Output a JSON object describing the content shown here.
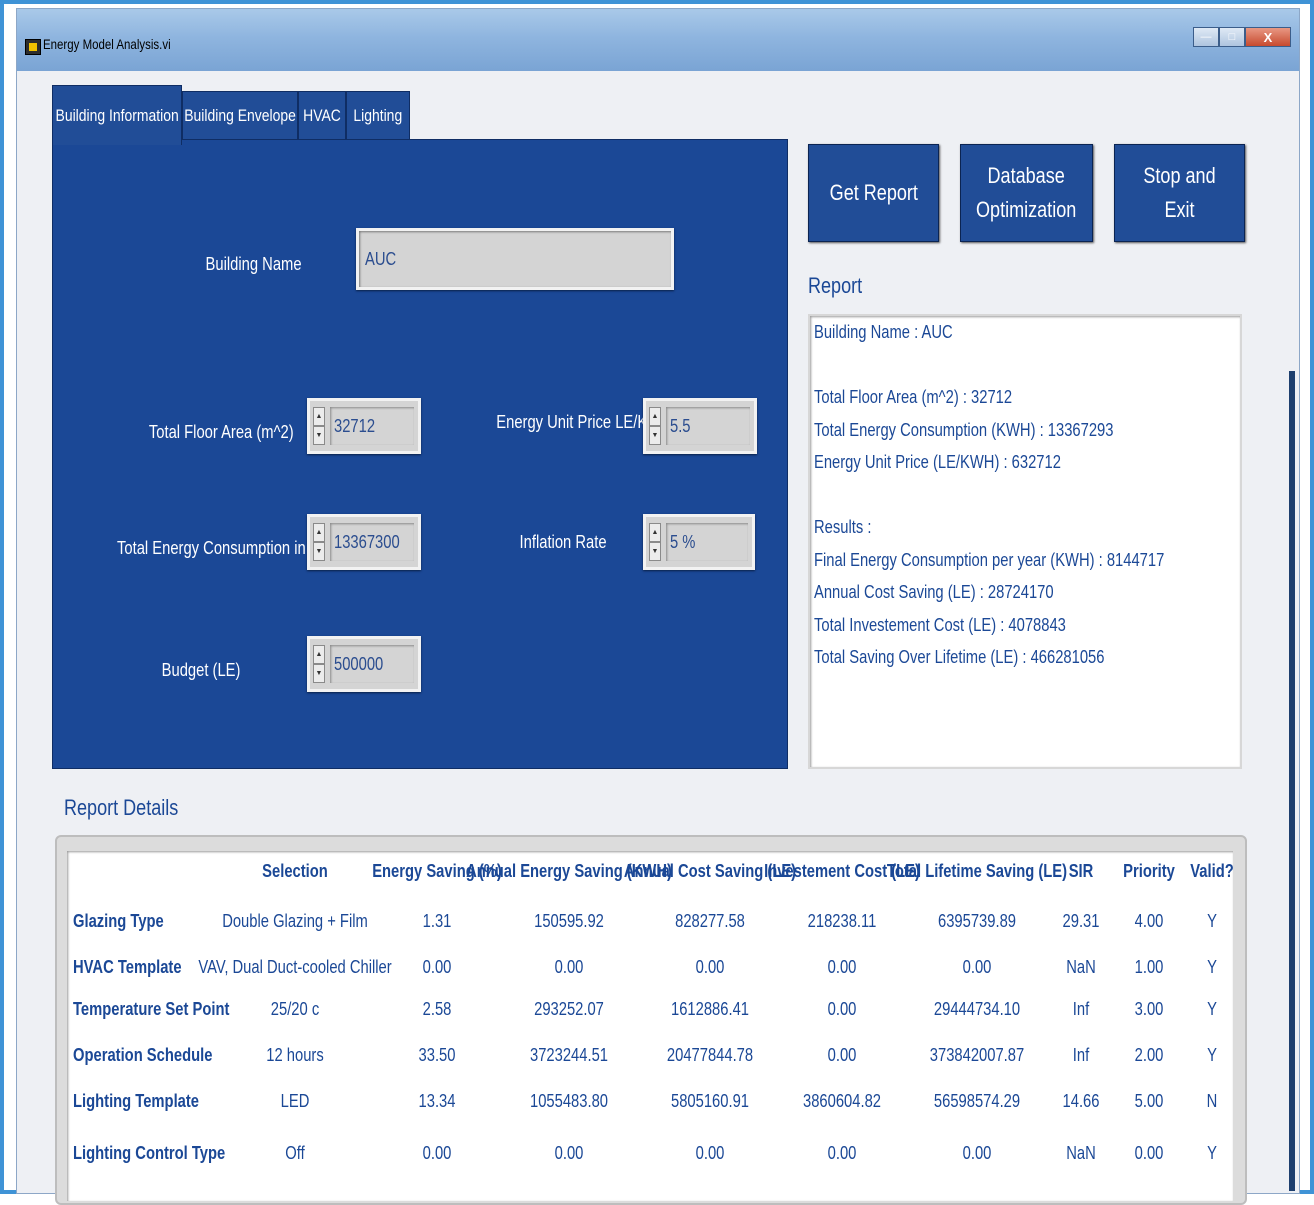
{
  "window": {
    "title": "Energy Model Analysis.vi"
  },
  "tabs": [
    "Building Information",
    "Building Envelope",
    "HVAC",
    "Lighting"
  ],
  "building_info": {
    "building_name_label": "Building Name",
    "building_name_value": "AUC",
    "floor_area_label": "Total Floor Area (m^2)",
    "floor_area_value": "32712",
    "energy_price_label": "Energy Unit Price LE/KWH",
    "energy_price_value": "5.5",
    "energy_consumption_label": "Total Energy Consumption in (KWH)",
    "energy_consumption_value": "13367300",
    "inflation_label": "Inflation Rate",
    "inflation_value": "5 %",
    "budget_label": "Budget (LE)",
    "budget_value": "500000"
  },
  "buttons": {
    "get_report": "Get Report",
    "database_optimization": "Database\nOptimization",
    "stop_exit": "Stop and Exit"
  },
  "report": {
    "label": "Report",
    "lines": [
      "Building Name : AUC",
      "",
      "Total Floor Area  (m^2) : 32712",
      "Total Energy Consumption  (KWH) : 13367293",
      "Energy Unit Price  (LE/KWH) : 632712",
      "",
      "Results :",
      "Final Energy Consumption per year  (KWH) :  8144717",
      "Annual Cost Saving (LE) : 28724170",
      "Total Investement Cost  (LE) : 4078843",
      "Total Saving Over Lifetime (LE) : 466281056"
    ]
  },
  "details": {
    "label": "Report Details",
    "headers": [
      "Selection",
      "Energy Saving (%)",
      "Annual Energy Saving (KWH)",
      "Annual Cost Saving (LE)",
      "Investement Cost (LE)",
      "Total Lifetime Saving (LE)",
      "SIR",
      "Priority",
      "Valid?"
    ],
    "rows": [
      {
        "name": "Glazing Type",
        "cells": [
          "Double Glazing + Film",
          "1.31",
          "150595.92",
          "828277.58",
          "218238.11",
          "6395739.89",
          "29.31",
          "4.00",
          "Y"
        ]
      },
      {
        "name": "HVAC Template",
        "cells": [
          "VAV, Dual Duct-cooled Chiller",
          "0.00",
          "0.00",
          "0.00",
          "0.00",
          "0.00",
          "NaN",
          "1.00",
          "Y"
        ]
      },
      {
        "name": "Temperature Set Point",
        "cells": [
          "25/20 c",
          "2.58",
          "293252.07",
          "1612886.41",
          "0.00",
          "29444734.10",
          "Inf",
          "3.00",
          "Y"
        ]
      },
      {
        "name": "Operation Schedule",
        "cells": [
          "12 hours",
          "33.50",
          "3723244.51",
          "20477844.78",
          "0.00",
          "373842007.87",
          "Inf",
          "2.00",
          "Y"
        ]
      },
      {
        "name": "Lighting Template",
        "cells": [
          "LED",
          "13.34",
          "1055483.80",
          "5805160.91",
          "3860604.82",
          "56598574.29",
          "14.66",
          "5.00",
          "N"
        ]
      },
      {
        "name": "Lighting Control Type",
        "cells": [
          "Off",
          "0.00",
          "0.00",
          "0.00",
          "0.00",
          "0.00",
          "NaN",
          "0.00",
          "Y"
        ]
      }
    ]
  }
}
